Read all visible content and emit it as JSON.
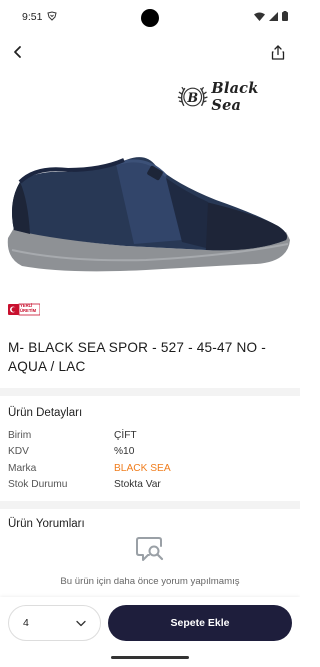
{
  "status_bar": {
    "time": "9:51"
  },
  "brand": {
    "logo_letter": "B",
    "logo_text": "Black Sea"
  },
  "warranty_badge": {
    "line1": "YERLİ",
    "line2": "ÜRETİM",
    "color": "#c8102e"
  },
  "product": {
    "title": "M- BLACK SEA SPOR - 527 - 45-47 NO - AQUA / LAC"
  },
  "details_section": {
    "title": "Ürün Detayları",
    "rows": [
      {
        "label": "Birim",
        "value": "ÇİFT"
      },
      {
        "label": "KDV",
        "value": "%10"
      },
      {
        "label": "Marka",
        "value": "BLACK SEA"
      },
      {
        "label": "Stok Durumu",
        "value": "Stokta Var"
      }
    ],
    "brand_color": "#f07d1d"
  },
  "reviews_section": {
    "title": "Ürün Yorumları",
    "empty_icon": "comment-search-icon",
    "empty_text": "Bu ürün için daha önce yorum yapılmamış"
  },
  "bottom_bar": {
    "quantity": "4",
    "add_to_cart_label": "Sepete Ekle",
    "button_color": "#1e1e3c"
  },
  "icons": {
    "back": "arrow-left-icon",
    "share": "share-icon",
    "dropdown": "chevron-down-icon"
  }
}
